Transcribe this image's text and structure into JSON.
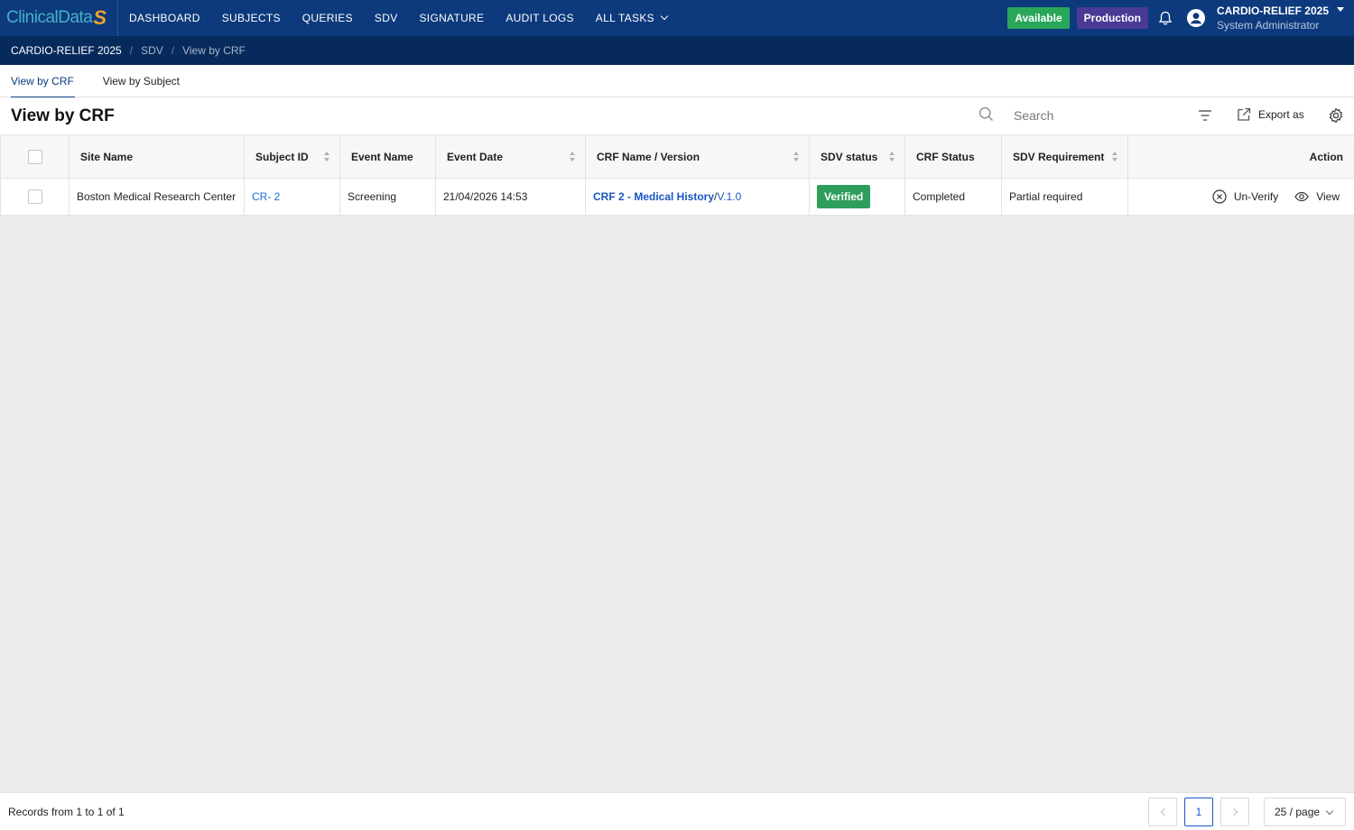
{
  "logo": {
    "text": "ClinicalData",
    "mark": "S"
  },
  "nav": {
    "items": [
      "DASHBOARD",
      "SUBJECTS",
      "QUERIES",
      "SDV",
      "SIGNATURE",
      "AUDIT LOGS",
      "ALL TASKS"
    ]
  },
  "status": {
    "available": "Available",
    "environment": "Production"
  },
  "user": {
    "study": "CARDIO-RELIEF 2025",
    "role": "System Administrator"
  },
  "breadcrumb": [
    "CARDIO-RELIEF 2025",
    "SDV",
    "View by CRF"
  ],
  "tabs": [
    "View by CRF",
    "View by Subject"
  ],
  "page": {
    "title": "View by CRF"
  },
  "search": {
    "placeholder": "Search"
  },
  "toolbar": {
    "export_label": "Export as"
  },
  "table": {
    "headers": [
      "Site Name",
      "Subject ID",
      "Event Name",
      "Event Date",
      "CRF Name / Version",
      "SDV status",
      "CRF Status",
      "SDV Requirement",
      "Action"
    ],
    "rows": [
      {
        "site": "Boston Medical Research Center",
        "subject": "CR- 2",
        "event": "Screening",
        "date": "21/04/2026 14:53",
        "crf_name": "CRF 2 - Medical History",
        "crf_sep": "/",
        "crf_version": "V.1.0",
        "sdv_status": "Verified",
        "crf_status": "Completed",
        "sdv_req": "Partial required",
        "action_unverify": "Un-Verify",
        "action_view": "View"
      }
    ]
  },
  "footer": {
    "records": "Records from 1 to 1 of 1",
    "current_page": "1",
    "page_size": "25 / page"
  },
  "colors": {
    "nav_bg": "#0c3a7c",
    "crumb_bg": "#072a5c",
    "available": "#2aa65a",
    "production": "#4a3a96",
    "verified": "#2e9e5c",
    "link": "#1a56c4"
  }
}
